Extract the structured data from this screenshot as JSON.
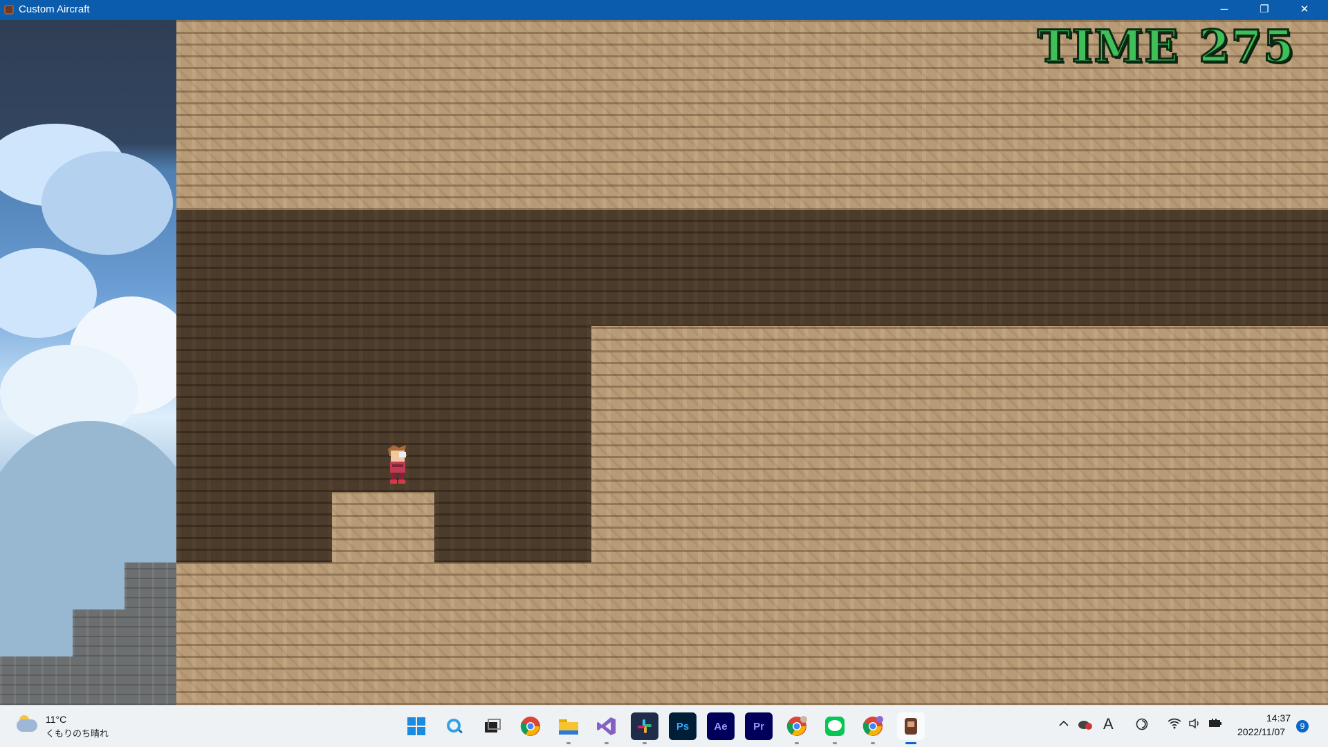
{
  "window": {
    "title": "Custom Aircraft",
    "controls": {
      "minimize": "─",
      "maximize": "❐",
      "close": "✕"
    }
  },
  "hud": {
    "time_label": "TIME",
    "time_value": "275"
  },
  "taskbar": {
    "weather": {
      "temperature": "11°C",
      "description": "くもりのち晴れ"
    },
    "apps": [
      {
        "name": "start",
        "label": ""
      },
      {
        "name": "search",
        "label": ""
      },
      {
        "name": "task-view",
        "label": ""
      },
      {
        "name": "chrome",
        "label": ""
      },
      {
        "name": "file-explorer",
        "label": ""
      },
      {
        "name": "visual-studio",
        "label": ""
      },
      {
        "name": "slack",
        "label": ""
      },
      {
        "name": "photoshop",
        "label": "Ps"
      },
      {
        "name": "after-effects",
        "label": "Ae"
      },
      {
        "name": "premiere",
        "label": "Pr"
      },
      {
        "name": "chrome-profile-2",
        "label": ""
      },
      {
        "name": "line",
        "label": ""
      },
      {
        "name": "chrome-profile-3",
        "label": ""
      },
      {
        "name": "custom-aircraft",
        "label": ""
      }
    ],
    "tray": {
      "ime": "A"
    },
    "clock": {
      "time": "14:37",
      "date": "2022/11/07"
    },
    "notifications": "9"
  }
}
